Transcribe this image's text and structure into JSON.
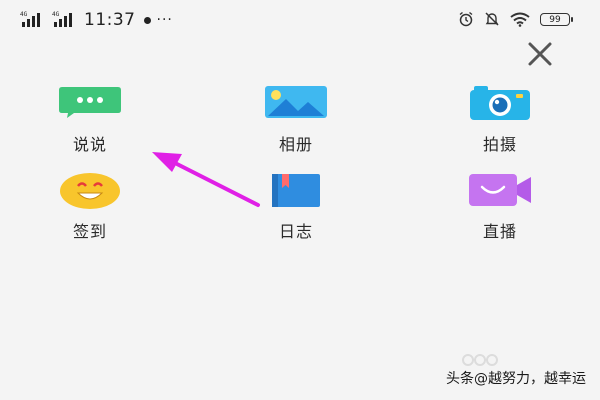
{
  "status_bar": {
    "signal_1_tag": "4G",
    "signal_2_tag": "4G",
    "time": "11:37",
    "more_indicator": "···",
    "battery_level": "99",
    "icons": [
      "alarm-icon",
      "mute-icon",
      "wifi-icon",
      "battery-icon"
    ]
  },
  "close_button": {
    "icon": "close-icon"
  },
  "grid": {
    "items": [
      {
        "label": "说说",
        "icon": "chat-bubble-icon",
        "color": "#3ec57a"
      },
      {
        "label": "相册",
        "icon": "photo-album-icon",
        "color": "#3fb8f0"
      },
      {
        "label": "拍摄",
        "icon": "camera-icon",
        "color": "#27b4e8"
      },
      {
        "label": "签到",
        "icon": "smiley-icon",
        "color": "#f8c52c"
      },
      {
        "label": "日志",
        "icon": "book-icon",
        "color": "#2f8de0"
      },
      {
        "label": "直播",
        "icon": "video-camera-icon",
        "color": "#c574f0"
      }
    ]
  },
  "annotation_arrow": {
    "color": "#e020e6",
    "points_to": "说说"
  },
  "footer": {
    "credit": "头条@越努力，越幸运"
  }
}
